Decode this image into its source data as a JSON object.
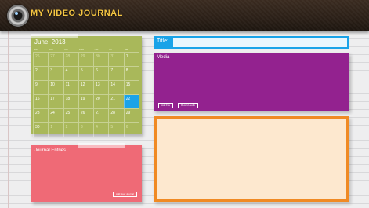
{
  "app": {
    "title": "MY VIDEO JOURNAL"
  },
  "calendar": {
    "month_label": "June, 2013",
    "weekdays": [
      "Sun",
      "Mon",
      "Tue",
      "Wed",
      "Thu",
      "Fri",
      "Sat"
    ],
    "weeks": [
      [
        "26",
        "27",
        "28",
        "29",
        "30",
        "31",
        "1"
      ],
      [
        "2",
        "3",
        "4",
        "5",
        "6",
        "7",
        "8"
      ],
      [
        "9",
        "10",
        "11",
        "12",
        "13",
        "14",
        "15"
      ],
      [
        "16",
        "17",
        "18",
        "19",
        "20",
        "21",
        "22"
      ],
      [
        "23",
        "24",
        "25",
        "26",
        "27",
        "28",
        "29"
      ],
      [
        "30",
        "1",
        "2",
        "3",
        "4",
        "5",
        "6"
      ]
    ],
    "selected_day": "22",
    "accent": "#1aa3e8"
  },
  "journal": {
    "title": "Journal Entries",
    "add_button": "Add New Journal"
  },
  "entry_title": {
    "label": "Title:",
    "value": ""
  },
  "media": {
    "title": "Media",
    "add_file_button": "Add File",
    "record_audio_button": "Record Audio"
  },
  "colors": {
    "calendar_note": "#a9b85a",
    "journal_note": "#ef6a76",
    "media_note": "#93228f",
    "title_bar": "#1aa3e8",
    "entry_border": "#f08a24"
  }
}
